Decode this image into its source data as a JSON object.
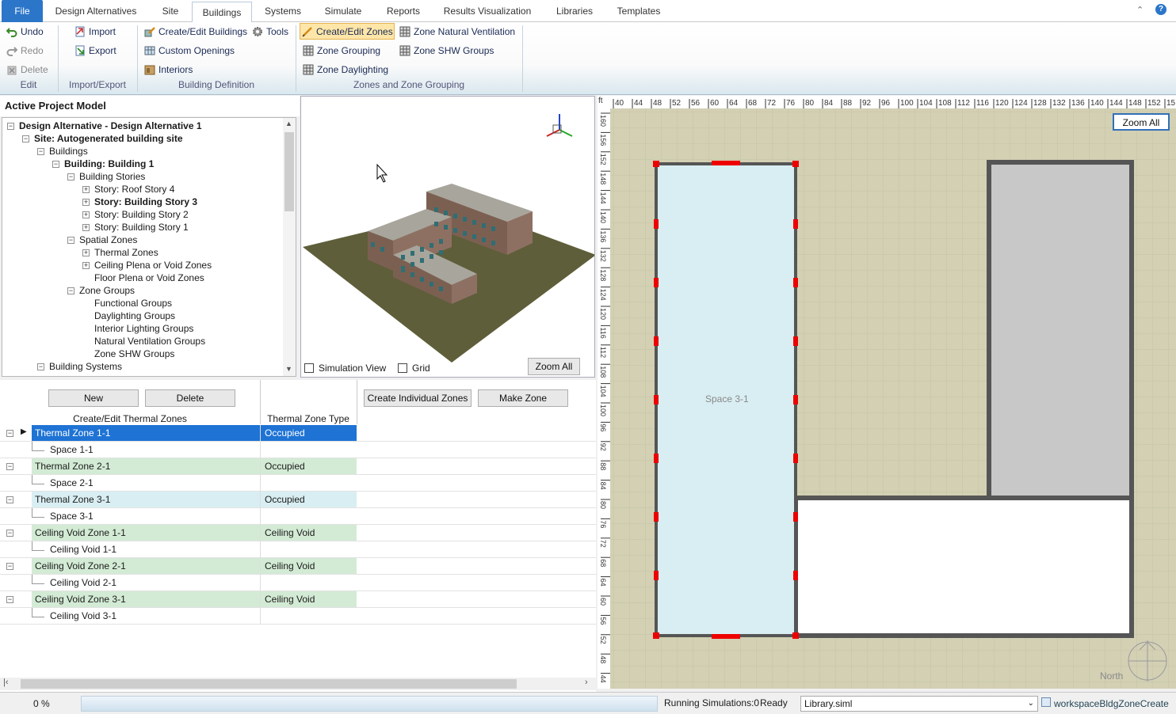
{
  "menu": {
    "tabs": [
      "File",
      "Design Alternatives",
      "Site",
      "Buildings",
      "Systems",
      "Simulate",
      "Reports",
      "Results Visualization",
      "Libraries",
      "Templates"
    ],
    "active": "Buildings"
  },
  "ribbon": {
    "undo": "Undo",
    "redo": "Redo",
    "delete": "Delete",
    "import": "Import",
    "export": "Export",
    "create_edit_buildings": "Create/Edit Buildings",
    "tools": "Tools",
    "custom_openings": "Custom Openings",
    "interiors": "Interiors",
    "create_edit_zones": "Create/Edit Zones",
    "zone_grouping": "Zone Grouping",
    "zone_daylighting": "Zone Daylighting",
    "zone_natural_ventilation": "Zone Natural Ventilation",
    "zone_shw_groups": "Zone SHW Groups",
    "groups": {
      "edit": "Edit",
      "import_export": "Import/Export",
      "building_definition": "Building Definition",
      "zones_grouping": "Zones and Zone Grouping"
    }
  },
  "tree": {
    "header": "Active Project Model",
    "nodes": [
      "Design Alternative - Design Alternative 1",
      "Site: Autogenerated building site",
      "Buildings",
      "Building: Building  1",
      "Building Stories",
      "Story: Roof Story 4",
      "Story: Building Story 3",
      "Story: Building Story 2",
      "Story: Building Story 1",
      "Spatial Zones",
      "Thermal Zones",
      "Ceiling Plena or Void Zones",
      "Floor Plena or Void Zones",
      "Zone Groups",
      "Functional Groups",
      "Daylighting Groups",
      "Interior Lighting Groups",
      "Natural Ventilation Groups",
      "Zone SHW Groups",
      "Building Systems"
    ]
  },
  "view3d": {
    "simulation_view": "Simulation View",
    "grid": "Grid",
    "zoom_all": "Zoom All"
  },
  "zones": {
    "new_button": "New",
    "delete_button": "Delete",
    "create_individual": "Create Individual Zones",
    "make_zone": "Make Zone",
    "col1": "Create/Edit Thermal Zones",
    "col2": "Thermal Zone Type",
    "rows": [
      {
        "name": "Thermal Zone 1-1",
        "type": "Occupied"
      },
      {
        "name": "Space 1-1",
        "type": ""
      },
      {
        "name": "Thermal Zone 2-1",
        "type": "Occupied"
      },
      {
        "name": "Space 2-1",
        "type": ""
      },
      {
        "name": "Thermal Zone 3-1",
        "type": "Occupied"
      },
      {
        "name": "Space 3-1",
        "type": ""
      },
      {
        "name": "Ceiling Void Zone 1-1",
        "type": "Ceiling Void"
      },
      {
        "name": "Ceiling Void 1-1",
        "type": ""
      },
      {
        "name": "Ceiling Void Zone 2-1",
        "type": "Ceiling Void"
      },
      {
        "name": "Ceiling Void 2-1",
        "type": ""
      },
      {
        "name": "Ceiling Void Zone 3-1",
        "type": "Ceiling Void"
      },
      {
        "name": "Ceiling Void 3-1",
        "type": ""
      }
    ]
  },
  "plan": {
    "zoom_all": "Zoom All",
    "space_label": "Space 3-1",
    "north": "North",
    "unit": "ft",
    "top_ruler": [
      "40",
      "44",
      "48",
      "52",
      "56",
      "60",
      "64",
      "68",
      "72",
      "76",
      "80",
      "84",
      "88",
      "92",
      "96",
      "100",
      "104",
      "108",
      "112",
      "116",
      "120",
      "124",
      "128",
      "132",
      "136",
      "140",
      "144",
      "148",
      "152",
      "15"
    ],
    "left_ruler": [
      "160",
      "156",
      "152",
      "148",
      "144",
      "140",
      "136",
      "132",
      "128",
      "124",
      "120",
      "116",
      "112",
      "108",
      "104",
      "100",
      "96",
      "92",
      "88",
      "84",
      "80",
      "76",
      "72",
      "68",
      "64",
      "60",
      "56",
      "52",
      "48",
      "44"
    ]
  },
  "status": {
    "progress": "0 %",
    "running": "Running Simulations:0",
    "ready": "Ready",
    "library": "Library.siml",
    "workspace": "workspaceBldgZoneCreate"
  }
}
